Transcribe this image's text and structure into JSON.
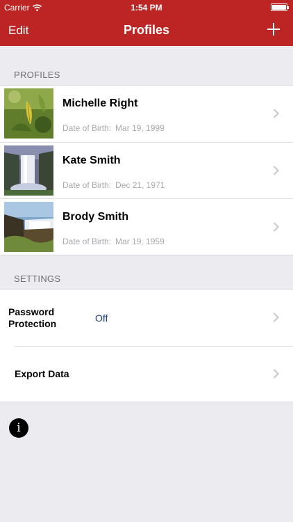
{
  "status_bar": {
    "carrier": "Carrier",
    "time": "1:54 PM"
  },
  "nav": {
    "edit_label": "Edit",
    "title": "Profiles",
    "add_icon": "plus-icon"
  },
  "profiles_section": {
    "header": "PROFILES",
    "dob_label": "Date of Birth:",
    "items": [
      {
        "name": "Michelle Right",
        "dob": "Mar 19, 1999",
        "image": "leaf-photo"
      },
      {
        "name": "Kate Smith",
        "dob": "Dec 21, 1971",
        "image": "waterfall-photo"
      },
      {
        "name": "Brody Smith",
        "dob": "Mar 19, 1959",
        "image": "waterfall-cliff-photo"
      }
    ]
  },
  "settings_section": {
    "header": "SETTINGS",
    "password_label_line1": "Password",
    "password_label_line2": "Protection",
    "password_value": "Off",
    "export_label": "Export Data"
  },
  "info_icon": "info-icon",
  "colors": {
    "nav_background": "#bd2424",
    "page_background": "#ebebf0",
    "value_text": "#1f3f7a"
  }
}
